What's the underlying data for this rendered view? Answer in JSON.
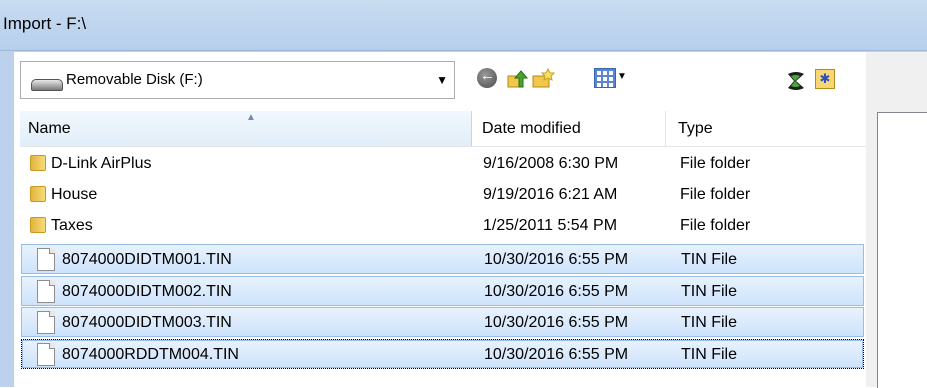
{
  "window": {
    "title": "Import - F:\\"
  },
  "location": {
    "label": "Removable Disk (F:)",
    "arrow": "▼"
  },
  "toolbar": {
    "back_glyph": "←",
    "view_arrow": "▼",
    "star_glyph": "✱"
  },
  "columns": {
    "name": "Name",
    "date": "Date modified",
    "type": "Type"
  },
  "rows": [
    {
      "name": "D-Link AirPlus",
      "date": "9/16/2008 6:30 PM",
      "type": "File folder"
    },
    {
      "name": "House",
      "date": "9/19/2016 6:21 AM",
      "type": "File folder"
    },
    {
      "name": "Taxes",
      "date": "1/25/2011 5:54 PM",
      "type": "File folder"
    },
    {
      "name": "8074000DIDTM001.TIN",
      "date": "10/30/2016 6:55 PM",
      "type": "TIN File"
    },
    {
      "name": "8074000DIDTM002.TIN",
      "date": "10/30/2016 6:55 PM",
      "type": "TIN File"
    },
    {
      "name": "8074000DIDTM003.TIN",
      "date": "10/30/2016 6:55 PM",
      "type": "TIN File"
    },
    {
      "name": "8074000RDDTM004.TIN",
      "date": "10/30/2016 6:55 PM",
      "type": "TIN File"
    }
  ]
}
